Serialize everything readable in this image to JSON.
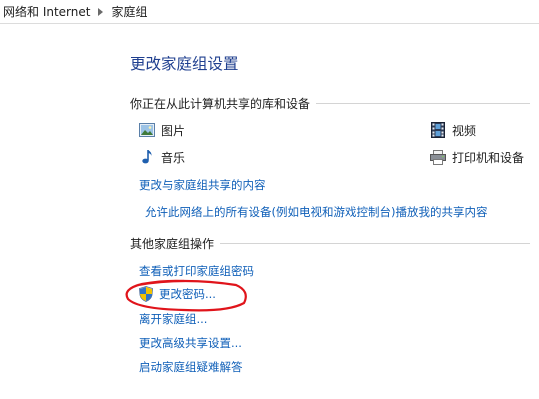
{
  "breadcrumb": {
    "items": [
      "网络和 Internet",
      "家庭组"
    ],
    "separator_icon": "chevron-right-icon"
  },
  "title": "更改家庭组设置",
  "sharing_section": {
    "header": "你正在从此计算机共享的库和设备",
    "libraries": [
      {
        "label": "图片",
        "icon": "pictures-icon"
      },
      {
        "label": "视频",
        "icon": "video-icon"
      },
      {
        "label": "音乐",
        "icon": "music-icon"
      },
      {
        "label": "打印机和设备",
        "icon": "printer-icon"
      }
    ],
    "links": [
      "更改与家庭组共享的内容",
      "允许此网络上的所有设备(例如电视和游戏控制台)播放我的共享内容"
    ]
  },
  "actions_section": {
    "header": "其他家庭组操作",
    "links": [
      "查看或打印家庭组密码",
      "更改密码...",
      "离开家庭组...",
      "更改高级共享设置...",
      "启动家庭组疑难解答"
    ],
    "shield_icon": "uac-shield-icon"
  },
  "colors": {
    "link": "#0f5fb8",
    "title": "#1f3f8f",
    "annotation": "#e0141b"
  }
}
